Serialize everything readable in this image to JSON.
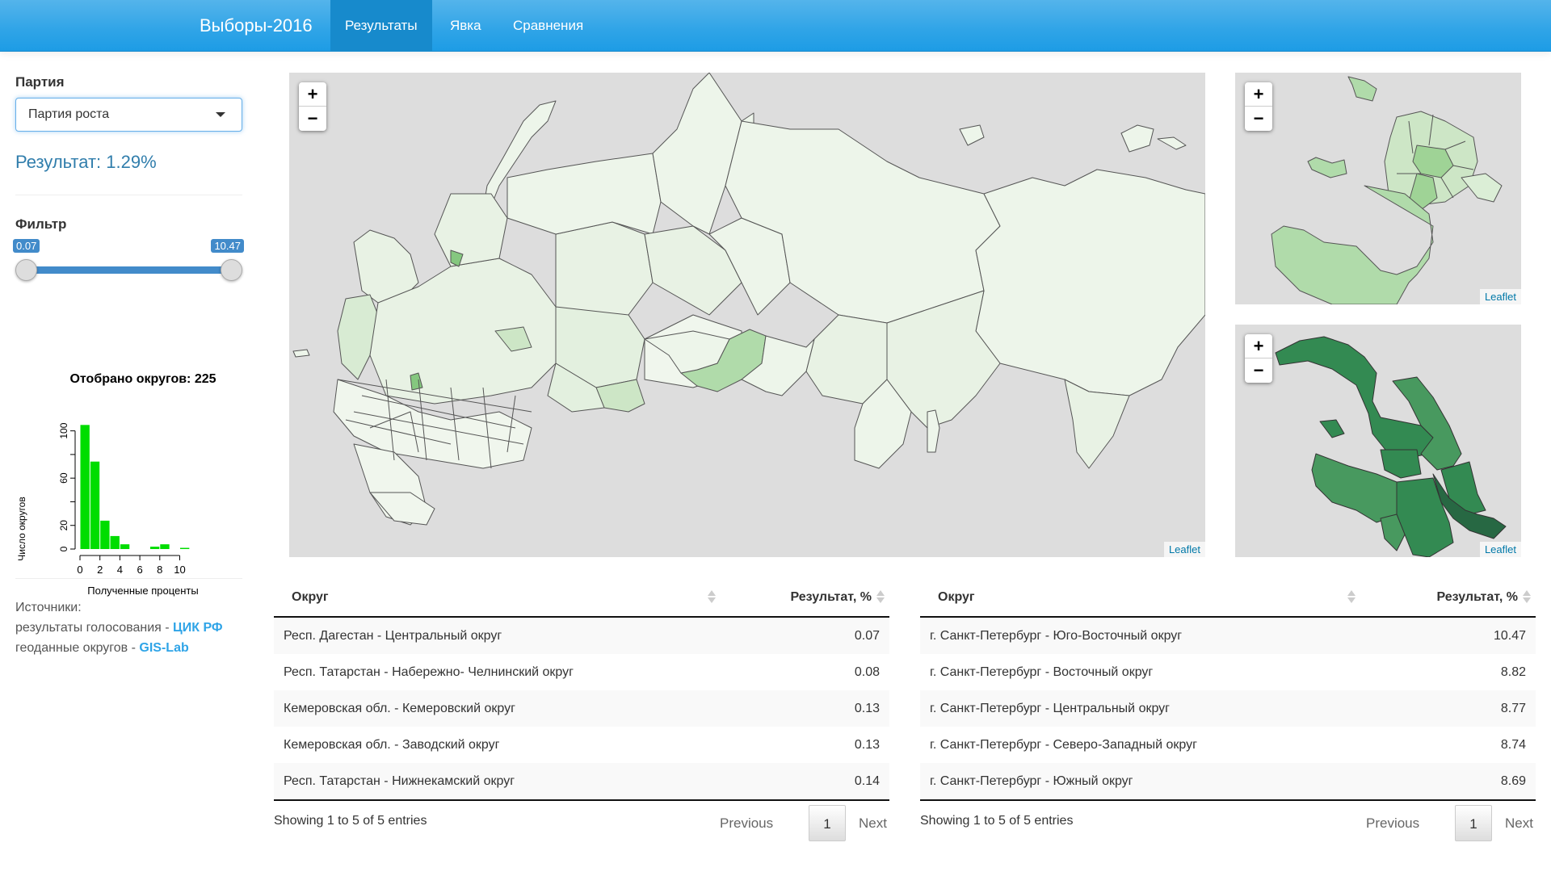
{
  "navbar": {
    "brand": "Выборы-2016",
    "tabs": [
      {
        "label": "Результаты",
        "active": true
      },
      {
        "label": "Явка",
        "active": false
      },
      {
        "label": "Сравнения",
        "active": false
      }
    ]
  },
  "sidebar": {
    "party_label": "Партия",
    "party_selected": "Партия роста",
    "result_text": "Результат: 1.29%",
    "filter_label": "Фильтр",
    "filter": {
      "min": 0.07,
      "max": 10.47,
      "min_label": "0.07",
      "max_label": "10.47"
    },
    "sources": {
      "title": "Источники:",
      "line1_prefix": "результаты голосования - ",
      "line1_link": "ЦИК РФ",
      "line2_prefix": "геоданные округов - ",
      "line2_link": "GIS-Lab"
    }
  },
  "chart_data": {
    "type": "bar",
    "title": "Отобрано округов: 225",
    "xlabel": "Полученные проценты",
    "ylabel": "Число округов",
    "bins": [
      [
        0,
        1
      ],
      [
        1,
        2
      ],
      [
        2,
        3
      ],
      [
        3,
        4
      ],
      [
        4,
        5
      ],
      [
        5,
        6
      ],
      [
        6,
        7
      ],
      [
        7,
        8
      ],
      [
        8,
        9
      ],
      [
        9,
        10
      ],
      [
        10,
        11
      ]
    ],
    "values": [
      105,
      74,
      24,
      11,
      4,
      0,
      0,
      2,
      4,
      0,
      1
    ],
    "xticks": [
      0,
      2,
      4,
      6,
      8,
      10
    ],
    "yticks": [
      0,
      20,
      60,
      100
    ],
    "ylim": [
      0,
      110
    ],
    "xlim": [
      0,
      11
    ],
    "bar_color": "#00dd00"
  },
  "maps": {
    "zoom_in": "+",
    "zoom_out": "−",
    "attribution": "Leaflet",
    "colors": {
      "water": "#dddddd",
      "very_low": "#edf5ea",
      "low": "#e3f0df",
      "mid_low": "#cde6c6",
      "mid": "#b0dbaa",
      "mid_high": "#85c77f",
      "high": "#48995f",
      "higher": "#338a52",
      "highest": "#276843"
    }
  },
  "table_low": {
    "headers": [
      "Округ",
      "Результат, %"
    ],
    "rows": [
      {
        "name": "Респ. Дагестан - Центральный округ",
        "value": "0.07"
      },
      {
        "name": "Респ. Татарстан - Набережно- Челнинский округ",
        "value": "0.08"
      },
      {
        "name": "Кемеровская обл. - Кемеровский округ",
        "value": "0.13"
      },
      {
        "name": "Кемеровская обл. - Заводский округ",
        "value": "0.13"
      },
      {
        "name": "Респ. Татарстан - Нижнекамский округ",
        "value": "0.14"
      }
    ],
    "info": "Showing 1 to 5 of 5 entries",
    "prev": "Previous",
    "page": "1",
    "next": "Next"
  },
  "table_high": {
    "headers": [
      "Округ",
      "Результат, %"
    ],
    "rows": [
      {
        "name": "г. Санкт-Петербург - Юго-Восточный округ",
        "value": "10.47"
      },
      {
        "name": "г. Санкт-Петербург - Восточный округ",
        "value": "8.82"
      },
      {
        "name": "г. Санкт-Петербург - Центральный округ",
        "value": "8.77"
      },
      {
        "name": "г. Санкт-Петербург - Северо-Западный округ",
        "value": "8.74"
      },
      {
        "name": "г. Санкт-Петербург - Южный округ",
        "value": "8.69"
      }
    ],
    "info": "Showing 1 to 5 of 5 entries",
    "prev": "Previous",
    "page": "1",
    "next": "Next"
  }
}
